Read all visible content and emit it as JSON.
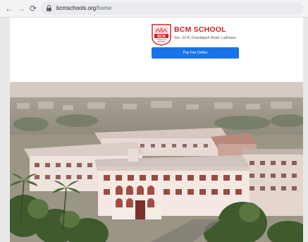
{
  "browser": {
    "url_host": "bcmschools.org",
    "url_path": "/home",
    "back_icon": "arrow-left-icon",
    "forward_icon": "arrow-right-icon",
    "reload_icon": "reload-icon",
    "lock_icon": "lock-icon"
  },
  "header": {
    "logo_text": "BCM",
    "school_name": "BCM SCHOOL",
    "address": "Sec. 32-A, Chandigarh Road, Ludhiana",
    "pay_button_label": "Pay Fee Online"
  },
  "colors": {
    "brand_red": "#d32027",
    "button_blue": "#1a73e8"
  },
  "hero": {
    "description_icon": "campus-aerial-photo"
  }
}
